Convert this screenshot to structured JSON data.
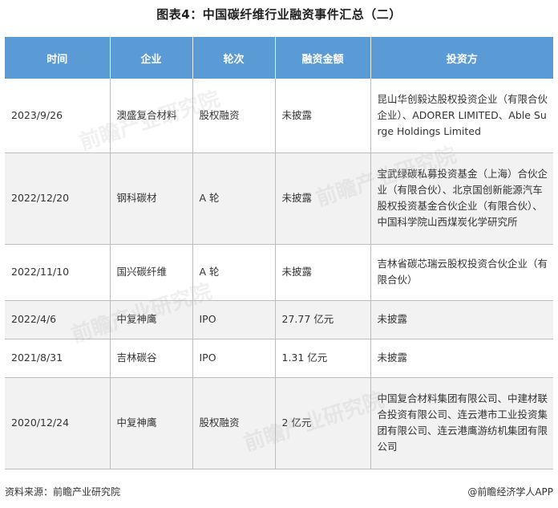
{
  "title": "图表4：中国碳纤维行业融资事件汇总（二）",
  "table": {
    "headers": [
      "时间",
      "企业",
      "轮次",
      "融资金额",
      "投资方"
    ],
    "rows": [
      {
        "time": "2023/9/26",
        "company": "澳盛复合材料",
        "round": "股权融资",
        "amount": "未披露",
        "investors": "昆山华创毅达股权投资企业（有限合伙企业）、ADORER LIMITED、Able Surge Holdings Limited"
      },
      {
        "time": "2022/12/20",
        "company": "钢科碳材",
        "round": "A 轮",
        "amount": "未披露",
        "investors": "宝武绿碳私募投资基金（上海）合伙企业（有限合伙）、北京国创新能源汽车股权投资基金合伙企业（有限合伙）、中国科学院山西煤炭化学研究所"
      },
      {
        "time": "2022/11/10",
        "company": "国兴碳纤维",
        "round": "A 轮",
        "amount": "未披露",
        "investors": "吉林省碳芯瑞云股权投资合伙企业（有限合伙）"
      },
      {
        "time": "2022/4/6",
        "company": "中复神鹰",
        "round": "IPO",
        "amount": "27.77 亿元",
        "investors": "未披露"
      },
      {
        "time": "2021/8/31",
        "company": "吉林碳谷",
        "round": "IPO",
        "amount": "1.31 亿元",
        "investors": "未披露"
      },
      {
        "time": "2020/12/24",
        "company": "中复神鹰",
        "round": "股权融资",
        "amount": "2 亿元",
        "investors": "中国复合材料集团有限公司、中建材联合投资有限公司、连云港市工业投资集团有限公司、连云港鹰游纺机集团有限公司"
      }
    ]
  },
  "footer": {
    "source": "资料来源：前瞻产业研究院",
    "brand": "@前瞻经济学人APP"
  },
  "watermark": "前瞻产业研究院",
  "colors": {
    "header_bg": "#5b9bd5",
    "even_row_bg": "#f2f2f2"
  }
}
